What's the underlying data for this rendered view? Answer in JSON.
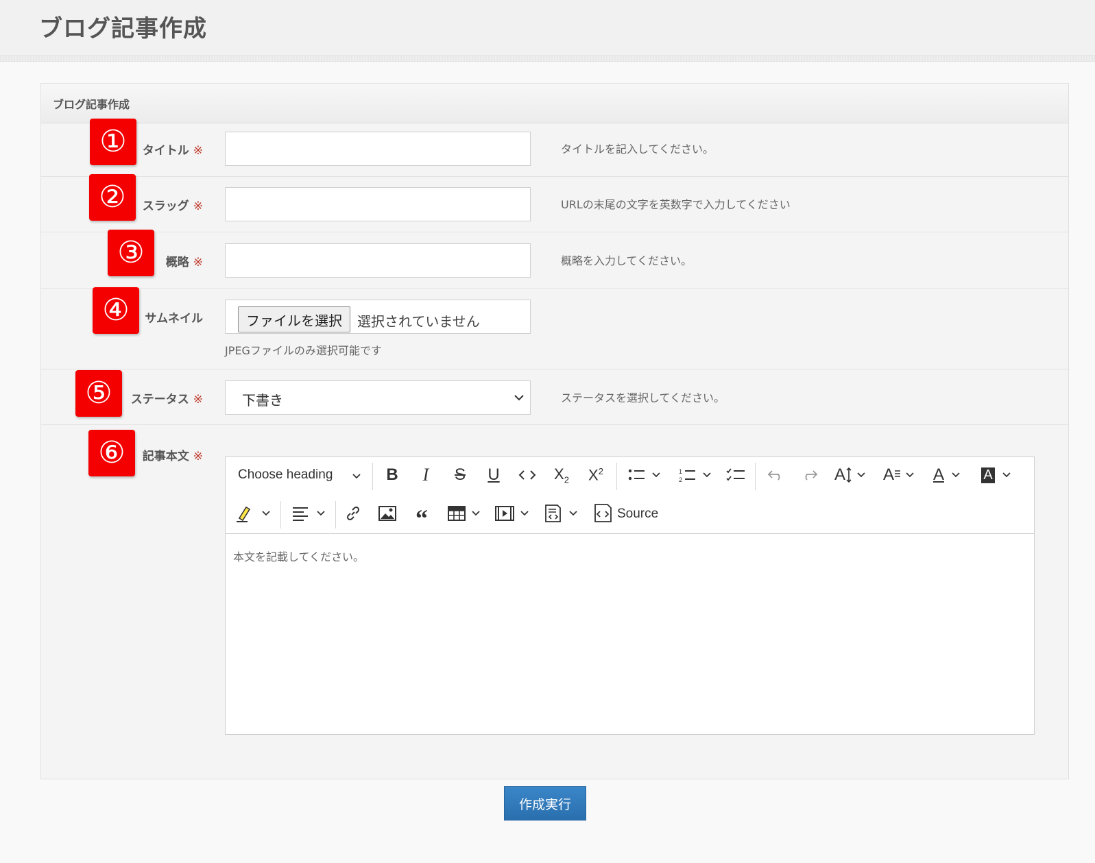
{
  "page": {
    "title": "ブログ記事作成"
  },
  "panel": {
    "heading": "ブログ記事作成"
  },
  "required_mark": "※",
  "markers": [
    "①",
    "②",
    "③",
    "④",
    "⑤",
    "⑥"
  ],
  "fields": {
    "title": {
      "label": "タイトル",
      "value": "",
      "help": "タイトルを記入してください。"
    },
    "slug": {
      "label": "スラッグ",
      "value": "",
      "help": "URLの末尾の文字を英数字で入力してください"
    },
    "summary": {
      "label": "概略",
      "value": "",
      "help": "概略を入力してください。"
    },
    "thumbnail": {
      "label": "サムネイル",
      "button_label": "ファイルを選択",
      "status": "選択されていません",
      "note": "JPEGファイルのみ選択可能です"
    },
    "status": {
      "label": "ステータス",
      "selected": "下書き",
      "help": "ステータスを選択してください。"
    },
    "body": {
      "label": "記事本文",
      "placeholder": "本文を記載してください。"
    }
  },
  "editor": {
    "heading_dropdown": "Choose heading",
    "source_label": "Source",
    "icons": [
      "bold-icon",
      "italic-icon",
      "strikethrough-icon",
      "underline-icon",
      "code-icon",
      "subscript-icon",
      "superscript-icon",
      "bulleted-list-icon",
      "numbered-list-icon",
      "todo-list-icon",
      "undo-icon",
      "redo-icon",
      "font-size-icon",
      "font-family-icon",
      "font-color-icon",
      "font-background-color-icon",
      "highlight-icon",
      "align-icon",
      "link-icon",
      "image-icon",
      "blockquote-icon",
      "table-icon",
      "media-icon",
      "html-embed-icon",
      "source-icon"
    ]
  },
  "submit": {
    "label": "作成実行"
  }
}
